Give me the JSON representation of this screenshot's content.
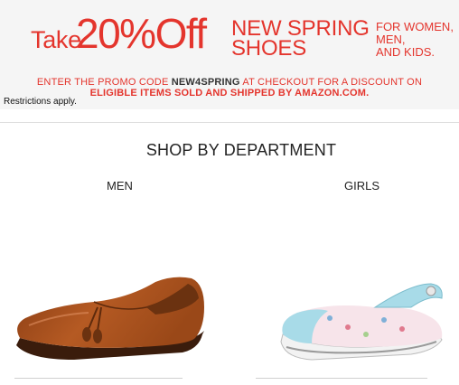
{
  "banner": {
    "take": "Take",
    "discount": "20%Off",
    "headline_line1": "NEW SPRING",
    "headline_line2": "SHOES",
    "audience_line1": "FOR WOMEN,",
    "audience_line2": "MEN,",
    "audience_line3": "AND KIDS.",
    "promo_prefix": "ENTER THE PROMO CODE ",
    "promo_code": "NEW4SPRING",
    "promo_suffix": " AT CHECKOUT FOR A DISCOUNT ON",
    "promo_line2": "ELIGIBLE ITEMS SOLD AND SHIPPED BY AMAZON.COM.",
    "restrictions": "Restrictions apply.",
    "accent_color": "#e4352d"
  },
  "section": {
    "title": "SHOP BY DEPARTMENT"
  },
  "departments": [
    {
      "label": "MEN",
      "image": "brown-tassel-loafer"
    },
    {
      "label": "GIRLS",
      "image": "floral-mary-jane-sneaker"
    }
  ]
}
